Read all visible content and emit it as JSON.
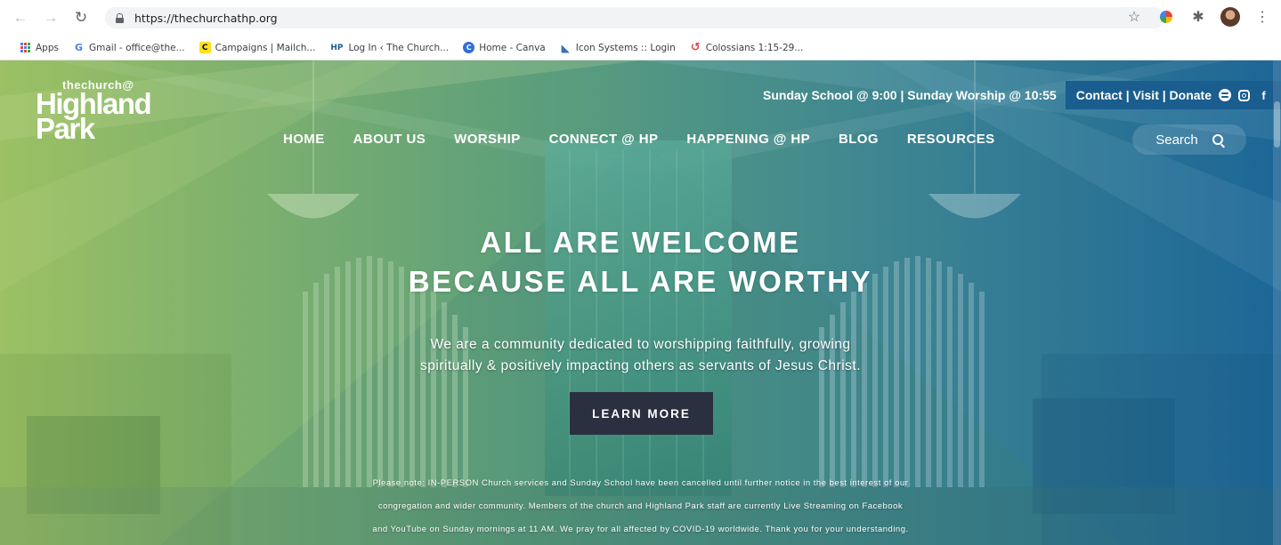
{
  "browser": {
    "url": "https://thechurchathp.org",
    "bookmarks": [
      {
        "label": "Apps",
        "icon": "apps-grid-icon"
      },
      {
        "label": "Gmail - office@the...",
        "icon": "google-icon"
      },
      {
        "label": "Campaigns | Mailch...",
        "icon": "mailchimp-icon"
      },
      {
        "label": "Log In ‹ The Church...",
        "icon": "hp-icon"
      },
      {
        "label": "Home - Canva",
        "icon": "canva-icon"
      },
      {
        "label": "Icon Systems :: Login",
        "icon": "icon-systems-icon"
      },
      {
        "label": "Colossians 1:15-29...",
        "icon": "colossians-icon"
      }
    ]
  },
  "site": {
    "logo": {
      "line1": "thechurch@",
      "line2": "Highland",
      "line3": "Park"
    },
    "topbar": {
      "times": "Sunday School @ 9:00 | Sunday Worship @ 10:55",
      "links": "Contact | Visit | Donate"
    },
    "nav": [
      "HOME",
      "ABOUT US",
      "WORSHIP",
      "CONNECT @ HP",
      "HAPPENING @ HP",
      "BLOG",
      "RESOURCES"
    ],
    "search_placeholder": "Search",
    "hero": {
      "headline_line1": "ALL ARE WELCOME",
      "headline_line2": "BECAUSE ALL ARE WORTHY",
      "sub_line1": "We are a community dedicated to worshipping faithfully, growing",
      "sub_line2": "spiritually & positively impacting others as servants of Jesus Christ.",
      "cta": "LEARN MORE",
      "notice_line1": "Please note: IN-PERSON Church services and Sunday School have been cancelled until further notice in the best interest of our",
      "notice_line2": "congregation and wider community. Members of the church and Highland Park staff are currently Live Streaming on Facebook",
      "notice_line3": "and YouTube on Sunday mornings at 11 AM. We pray for all affected by COVID-19 worldwide. Thank you for your understanding."
    }
  },
  "colors": {
    "hero_left": "#8fb85a",
    "hero_right": "#1f6a98",
    "topbar_accent": "#1a5d8f",
    "cta_bg": "#2b3040"
  }
}
